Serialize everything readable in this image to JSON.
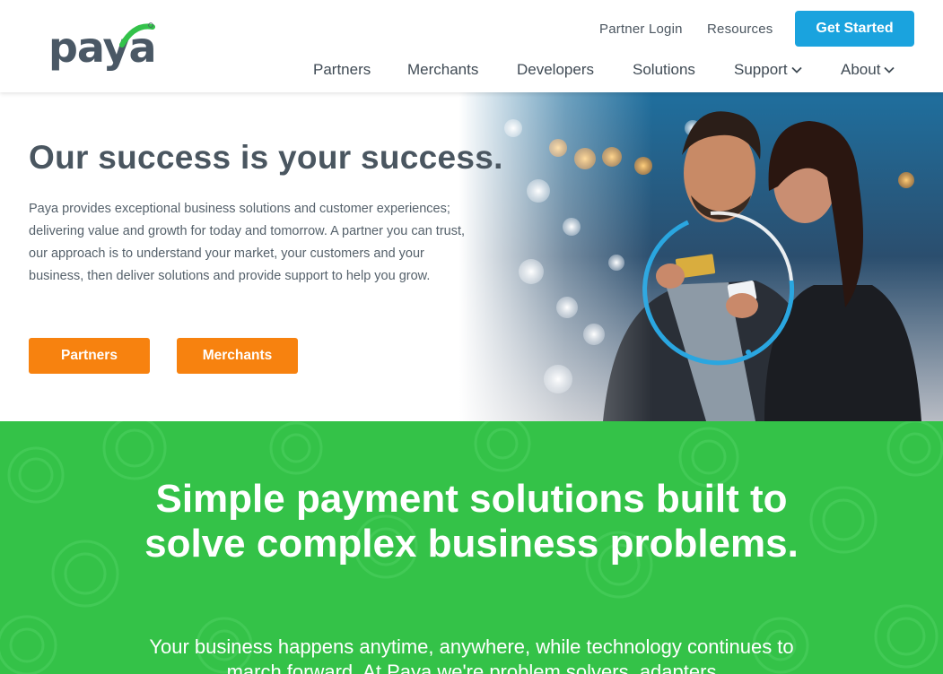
{
  "header": {
    "logo_alt": "paya",
    "utility_links": [
      "Partner Login",
      "Resources"
    ],
    "cta_label": "Get Started",
    "nav": [
      "Partners",
      "Merchants",
      "Developers",
      "Solutions",
      "Support",
      "About"
    ]
  },
  "hero": {
    "title": "Our success is your success.",
    "description": "Paya provides exceptional business solutions and customer experiences; delivering value and growth for today and tomorrow. A partner you can trust, our approach is to understand your market, your customers and your business, then deliver solutions and provide support to help you grow.",
    "buttons": [
      "Partners",
      "Merchants"
    ]
  },
  "green_section": {
    "title": "Simple payment solutions built to solve complex business problems.",
    "subtitle": "Your business happens anytime, anywhere, while technology continues to march forward. At Paya we're problem solvers, adapters"
  },
  "colors": {
    "brand_blue": "#1aa3de",
    "orange": "#f7820f",
    "green": "#34c248",
    "text_gray": "#4a5660"
  }
}
